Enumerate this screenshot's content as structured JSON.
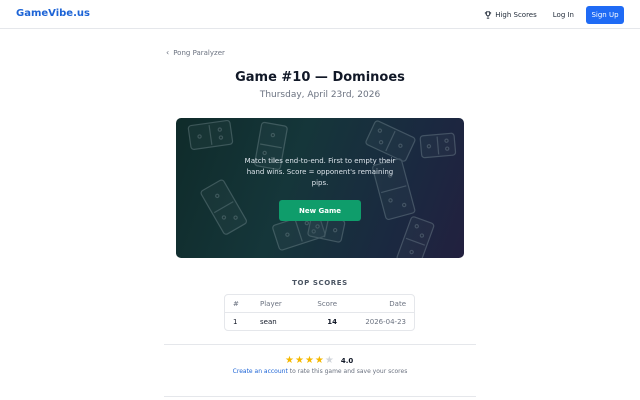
{
  "header": {
    "brand": "GameVibe.us",
    "high_scores_label": "High Scores",
    "login_label": "Log In",
    "signup_label": "Sign Up"
  },
  "breadcrumb": {
    "back_label": "Pong Paralyzer"
  },
  "game": {
    "title": "Game #10 — Dominoes",
    "date": "Thursday, April 23rd, 2026",
    "description": "Match tiles end-to-end. First to empty their hand wins. Score = opponent's remaining pips.",
    "new_game_label": "New Game"
  },
  "top_scores": {
    "heading": "TOP SCORES",
    "columns": {
      "rank": "#",
      "player": "Player",
      "score": "Score",
      "date": "Date"
    },
    "rows": [
      {
        "rank": "1",
        "player": "sean",
        "score": "14",
        "date": "2026-04-23"
      }
    ]
  },
  "rating": {
    "value": "4.0",
    "stars_filled": 4,
    "stars_total": 5,
    "star_color": "#f5b800",
    "link_text": "Create an account",
    "suffix_text": " to rate this game and save your scores"
  },
  "colors": {
    "brand": "#1d64d6",
    "signup_bg": "#1f6bf5",
    "new_game_bg": "#0f9d6b"
  }
}
